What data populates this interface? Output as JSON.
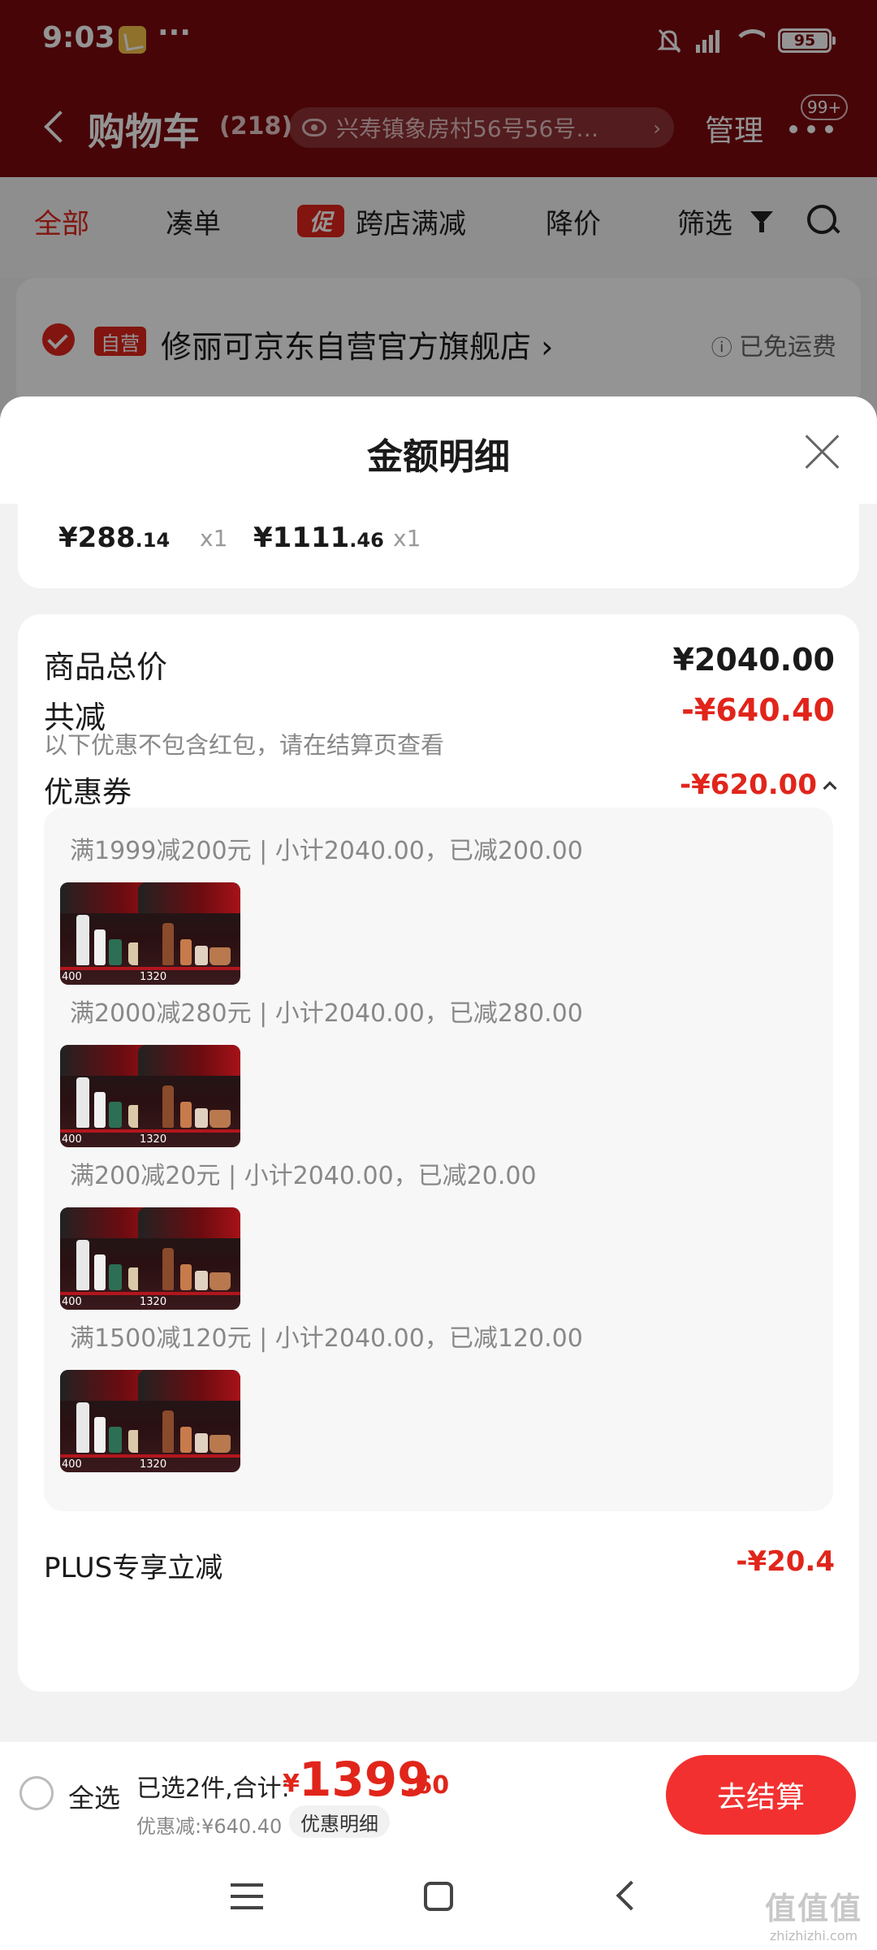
{
  "status_bar": {
    "time": "9:03",
    "more": "···",
    "battery": "95"
  },
  "header": {
    "title": "购物车",
    "count": "(218)",
    "address": "兴寿镇象房村56号56号…",
    "manage": "管理",
    "badge": "99+"
  },
  "tabs": [
    {
      "label": "全部"
    },
    {
      "label": "凑单"
    },
    {
      "label": "跨店满减",
      "promo_tag": "促"
    },
    {
      "label": "降价"
    },
    {
      "label": "筛选"
    }
  ],
  "shop": {
    "tag": "自营",
    "name": "修丽可京东自营官方旗舰店 ›",
    "shipping": "已免运费"
  },
  "sheet": {
    "title": "金额明细",
    "items": [
      {
        "price_int": "¥288",
        "price_dec": ".14",
        "qty": "x1"
      },
      {
        "price_int": "¥1111",
        "price_dec": ".46",
        "qty": "x1"
      }
    ],
    "total_label": "商品总价",
    "total_value": "¥2040.00",
    "reduce_label": "共减",
    "reduce_value": "-¥640.40",
    "note": "以下优惠不包含红包，请在结算页查看",
    "coupon_label": "优惠券",
    "coupon_value": "-¥620.00",
    "coupon_rules": [
      {
        "text": "满1999减200元 | 小计2040.00，已减200.00"
      },
      {
        "text": "满2000减280元 | 小计2040.00，已减280.00"
      },
      {
        "text": "满200减20元 | 小计2040.00，已减20.00"
      },
      {
        "text": "满1500减120元 | 小计2040.00，已减120.00"
      }
    ],
    "thumb_labels": [
      "400",
      "1320"
    ],
    "plus_label": "PLUS专享立减",
    "plus_value": "-¥20.4"
  },
  "bottom_bar": {
    "select_all": "全选",
    "selected": "已选2件,合计:",
    "total_yen": "¥",
    "total_int": "1399",
    "total_dec": ".60",
    "discount": "优惠减:¥640.40",
    "detail_button": "优惠明细",
    "checkout": "去结算"
  },
  "watermark": {
    "big": "值值值",
    "small": "zhizhizhi.com"
  },
  "colors": {
    "brand_red": "#e1251b",
    "header_bg": "#7a0a0e",
    "checkout_btn": "#f23030"
  }
}
